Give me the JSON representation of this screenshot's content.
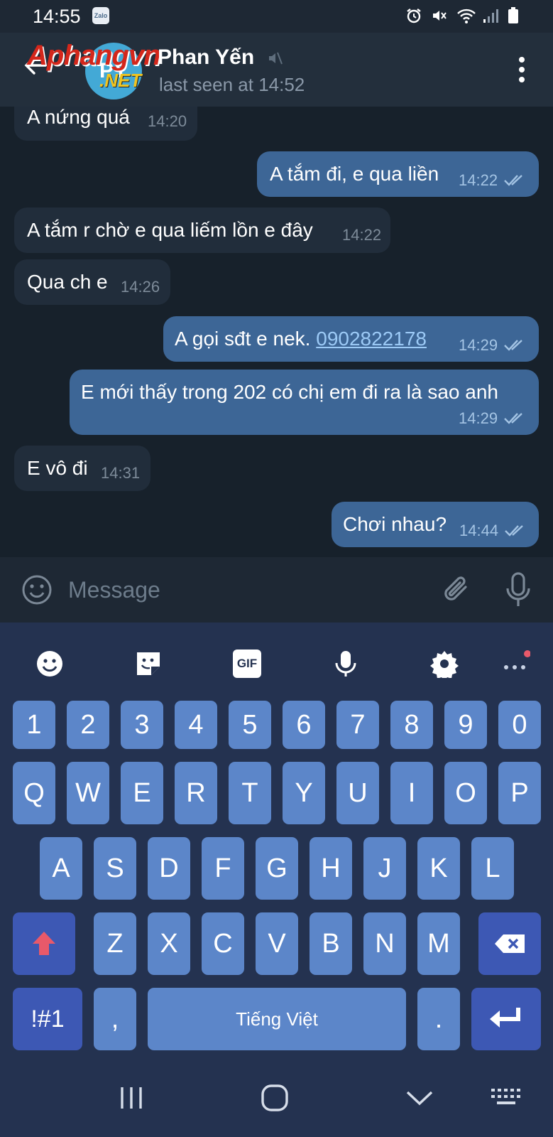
{
  "status_bar": {
    "time": "14:55",
    "app_badge": "Zalo"
  },
  "header": {
    "watermark_main": "Aphangvn",
    "watermark_sub": ".NET",
    "avatar_initials": "PY",
    "name": "Phan Yến",
    "last_seen": "last seen at 14:52"
  },
  "messages": [
    {
      "dir": "in",
      "text": "A nứng quá",
      "time": "14:20"
    },
    {
      "dir": "out",
      "text": "A tắm đi, e qua liền",
      "time": "14:22"
    },
    {
      "dir": "in",
      "text": "A tắm r chờ e qua liếm lồn e đây",
      "time": "14:22"
    },
    {
      "dir": "in",
      "text": "Qua ch e",
      "time": "14:26"
    },
    {
      "dir": "out",
      "text": "A gọi sđt e nek. ",
      "link": "0902822178",
      "time": "14:29"
    },
    {
      "dir": "out",
      "text": "E mới thấy trong 202 có chị em đi ra là sao anh",
      "time": "14:29"
    },
    {
      "dir": "in",
      "text": "E vô đi",
      "time": "14:31"
    },
    {
      "dir": "out",
      "text": "Chơi nhau?",
      "time": "14:44"
    }
  ],
  "input": {
    "placeholder": "Message"
  },
  "keyboard": {
    "toolbar": [
      "emoji-icon",
      "sticker-icon",
      "gif-icon",
      "voice-input-icon",
      "settings-icon",
      "more-icon"
    ],
    "gif_label": "GIF",
    "row_numbers": [
      "1",
      "2",
      "3",
      "4",
      "5",
      "6",
      "7",
      "8",
      "9",
      "0"
    ],
    "row_top": [
      "Q",
      "W",
      "E",
      "R",
      "T",
      "Y",
      "U",
      "I",
      "O",
      "P"
    ],
    "row_middle": [
      "A",
      "S",
      "D",
      "F",
      "G",
      "H",
      "J",
      "K",
      "L"
    ],
    "row_bottom": [
      "Z",
      "X",
      "C",
      "V",
      "B",
      "N",
      "M"
    ],
    "symbols_label": "!#1",
    "comma_label": ",",
    "space_label": "Tiếng Việt",
    "period_label": "."
  },
  "colors": {
    "chat_bg": "#17212b",
    "incoming_bubble": "#212d3b",
    "outgoing_bubble": "#3d6696",
    "key": "#5c86c9",
    "key_dark": "#3d58b4",
    "keyboard_bg": "#243250"
  }
}
